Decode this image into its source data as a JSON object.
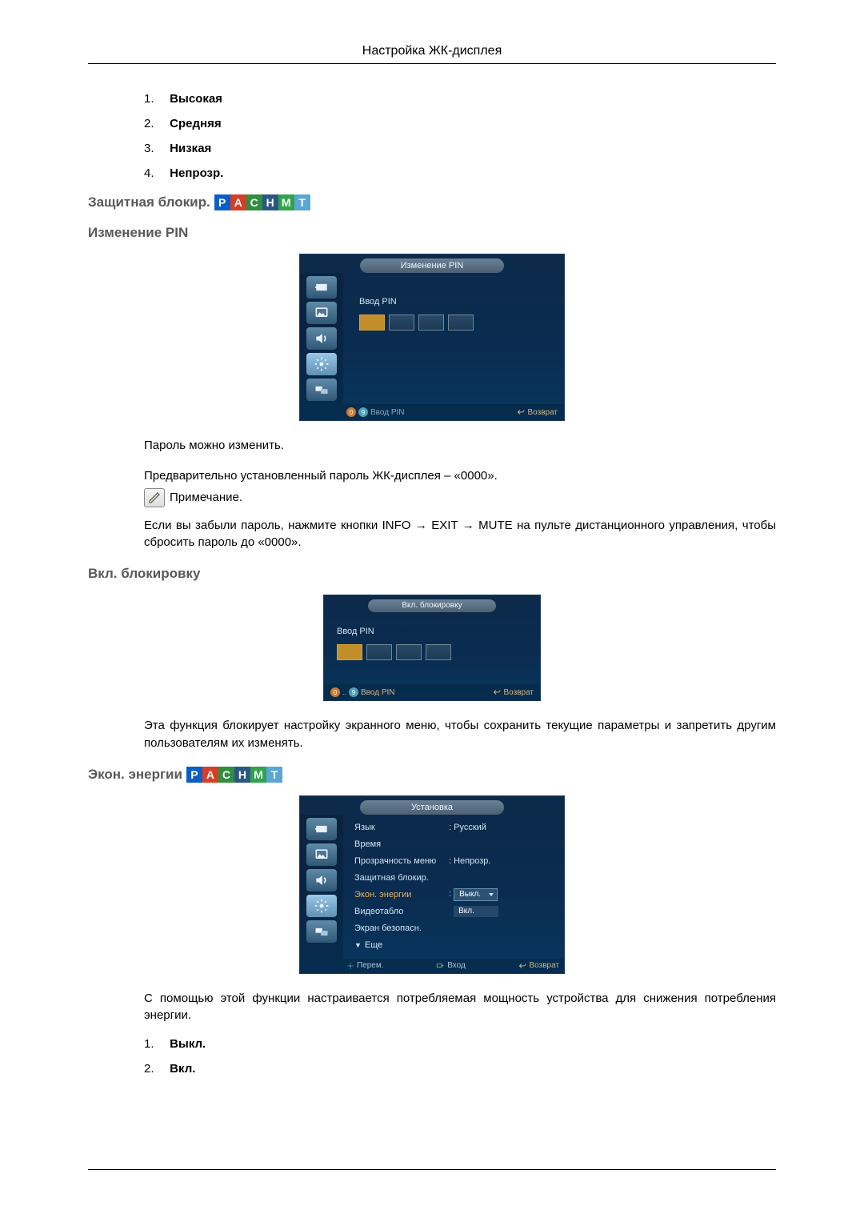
{
  "header": "Настройка ЖК-дисплея",
  "list1": [
    {
      "num": "1.",
      "label": "Высокая"
    },
    {
      "num": "2.",
      "label": "Средняя"
    },
    {
      "num": "3.",
      "label": "Низкая"
    },
    {
      "num": "4.",
      "label": "Непрозр."
    }
  ],
  "sec_lock_heading": "Защитная блокир.",
  "icon_letters": {
    "p": "P",
    "a": "A",
    "c": "C",
    "h": "H",
    "m": "M",
    "t": "T"
  },
  "sec_change_pin_heading": "Изменение PIN",
  "osd_pin": {
    "title": "Изменение PIN",
    "enter_label": "Ввод PIN",
    "footer_left": "Ввод PIN",
    "footer_right": "Возврат"
  },
  "para_change": "Пароль можно изменить.",
  "para_default": "Предварительно установленный пароль ЖК-дисплея – «0000».",
  "note_label": "Примечание.",
  "para_forgot": "Если вы забыли пароль, нажмите кнопки INFO → EXIT → MUTE на пульте дистанционного управления, чтобы сбросить пароль до «0000».",
  "sec_lock_on_heading": "Вкл. блокировку",
  "osd_lock": {
    "title": "Вкл. блокировку",
    "enter_label": "Ввод PIN",
    "footer_left_prefix": "0..9",
    "footer_left": "Ввод PIN",
    "footer_right": "Возврат"
  },
  "para_lock": "Эта функция блокирует настройку экранного меню, чтобы сохранить текущие параметры и запретить другим пользователям их изменять.",
  "sec_energy_heading": "Экон. энергии",
  "osd_settings": {
    "title": "Установка",
    "rows": {
      "lang_label": "Язык",
      "lang_value": ": Русский",
      "time_label": "Время",
      "transp_label": "Прозрачность меню",
      "transp_value": ": Непрозр.",
      "protect_label": "Защитная блокир.",
      "energy_label": "Экон. энергии",
      "energy_sel": "Выкл.",
      "energy_opt": "Вкл.",
      "video_label": "Видеотабло",
      "safe_label": "Экран безопасн.",
      "more_label": "Еще"
    },
    "footer": {
      "move": "Перем.",
      "enter": "Вход",
      "return": "Возврат"
    }
  },
  "para_energy": "С помощью этой функции настраивается потребляемая мощность устройства для снижения потребления энергии.",
  "list2": [
    {
      "num": "1.",
      "label": "Выкл."
    },
    {
      "num": "2.",
      "label": "Вкл."
    }
  ]
}
